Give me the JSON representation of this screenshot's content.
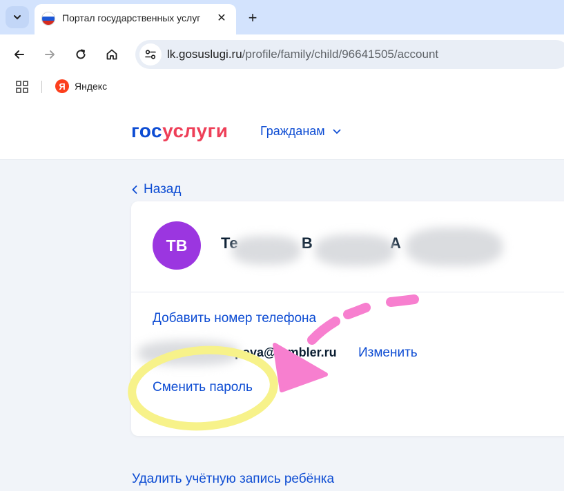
{
  "browser": {
    "tab_title": "Портал государственных услуг",
    "tab_close": "✕",
    "new_tab": "+",
    "url_host": "lk.gosuslugi.ru",
    "url_path": "/profile/family/child/96641505/account",
    "bookmark_label": "Яндекс",
    "bookmark_icon_letter": "Я"
  },
  "header": {
    "logo_part1": "гос",
    "logo_part2": "услуги",
    "nav_label": "Гражданам"
  },
  "page": {
    "back_label": "Назад",
    "avatar_initials": "ТВ",
    "name_part1": "Те",
    "name_part2": "В",
    "name_part3": "А",
    "add_phone_label": "Добавить номер телефона",
    "email_visible": "pova@rambler.ru",
    "change_label": "Изменить",
    "change_password_label": "Сменить пароль",
    "delete_label": "Удалить учётную запись ребёнка"
  },
  "colors": {
    "brand_blue": "#0d4cd3",
    "brand_red": "#ee3f58",
    "avatar": "#9b36e0",
    "annotation_yellow": "#f7f28a",
    "annotation_pink": "#f77fcf"
  },
  "icons": {
    "tab_menu": "chevron-down-icon",
    "back": "arrow-left-icon",
    "forward": "arrow-right-icon",
    "reload": "reload-icon",
    "home": "home-icon",
    "site_info": "tune-icon",
    "apps": "apps-grid-icon",
    "nav_dropdown": "chevron-down-icon",
    "back_link": "chevron-left-icon"
  }
}
